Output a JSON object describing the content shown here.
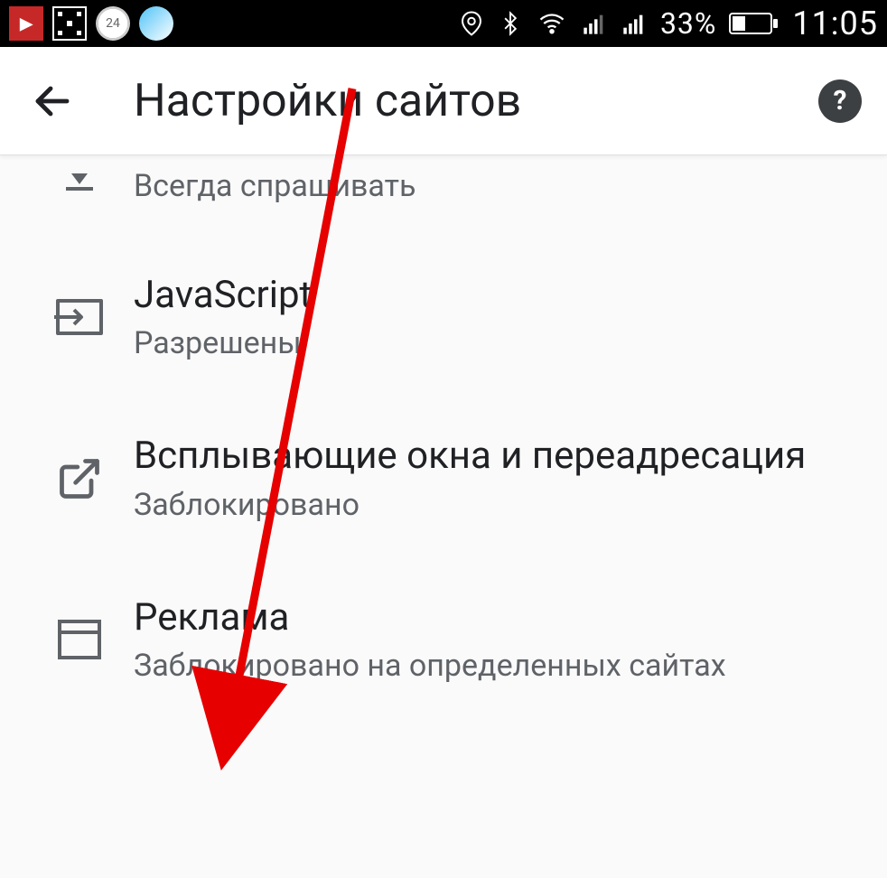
{
  "status": {
    "battery_pct": "33%",
    "time": "11:05"
  },
  "header": {
    "title": "Настройки сайтов"
  },
  "rows": {
    "partial": {
      "sub": "Всегда спрашивать"
    },
    "js": {
      "title": "JavaScript",
      "sub": "Разрешены"
    },
    "popups": {
      "title": "Всплывающие окна и переадресация",
      "sub": "Заблокировано"
    },
    "ads": {
      "title": "Реклама",
      "sub": "Заблокировано на определенных сайтах"
    }
  }
}
